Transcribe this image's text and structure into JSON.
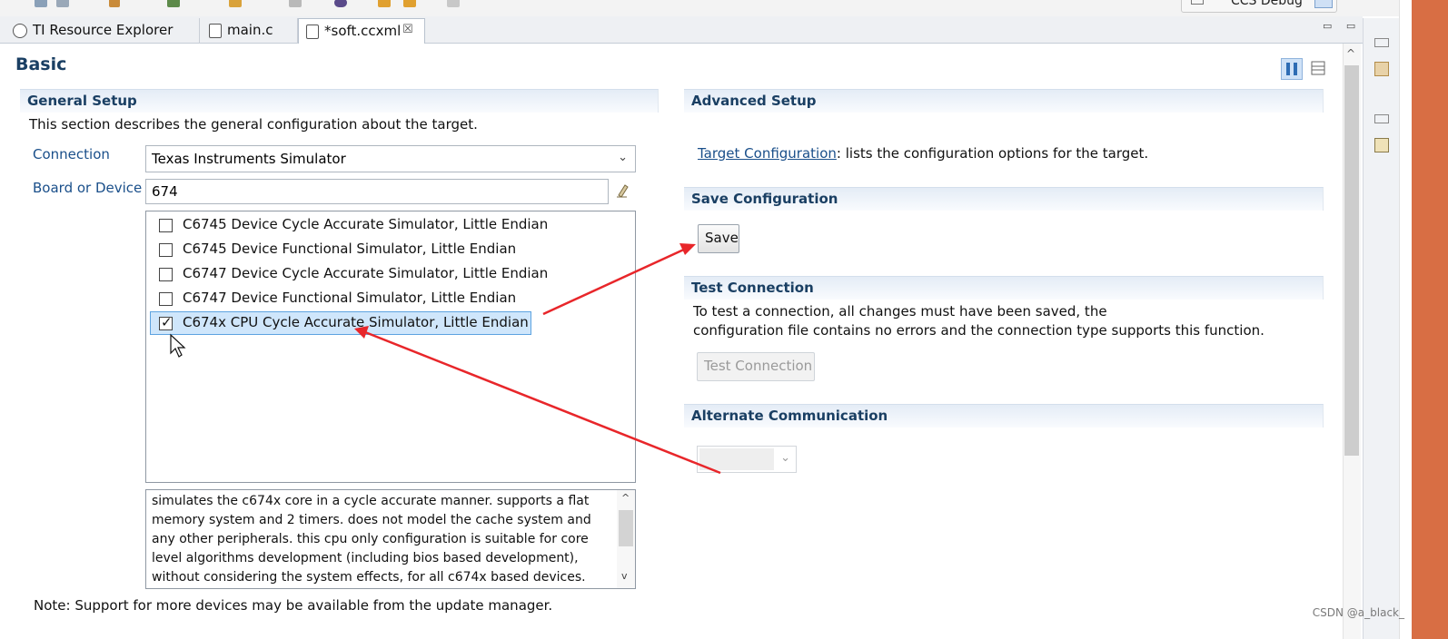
{
  "perspective": {
    "label": "CCS Debug"
  },
  "tabs": [
    {
      "label": "TI Resource Explorer",
      "icon": "compass-icon"
    },
    {
      "label": "main.c",
      "icon": "c-file-icon"
    },
    {
      "label": "*soft.ccxml",
      "icon": "target-config-file-icon",
      "active": true,
      "close": "☒"
    }
  ],
  "view_controls": "▭ ▭",
  "page": {
    "title": "Basic"
  },
  "general": {
    "header": "General Setup",
    "description": "This section describes the general configuration about the target.",
    "connection_label": "Connection",
    "connection_value": "Texas Instruments Simulator",
    "device_label": "Board or Device",
    "device_filter": "674",
    "devices": [
      {
        "label": "C6745 Device Cycle Accurate Simulator, Little Endian",
        "checked": false
      },
      {
        "label": "C6745 Device Functional Simulator, Little Endian",
        "checked": false
      },
      {
        "label": "C6747 Device Cycle Accurate Simulator, Little Endian",
        "checked": false
      },
      {
        "label": "C6747 Device Functional Simulator, Little Endian",
        "checked": false
      },
      {
        "label": "C674x CPU Cycle Accurate Simulator, Little Endian",
        "checked": true
      }
    ],
    "device_description": "simulates the c674x core in a cycle accurate manner. supports a flat memory system and 2 timers. does not model the cache system and any other peripherals.  this cpu only configuration is suitable for core level algorithms development (including bios based development), without considering the system effects, for all c674x based devices.",
    "note": "Note: Support for more devices may be available from the update manager."
  },
  "advanced": {
    "header": "Advanced Setup",
    "link_text": "Target Configuration",
    "link_suffix": ": lists the configuration options for the target."
  },
  "save": {
    "header": "Save Configuration",
    "button": "Save"
  },
  "test": {
    "header": "Test Connection",
    "line1": "To test a connection, all changes must have been saved, the",
    "line2": "configuration file contains no errors and the connection type supports this function.",
    "button": "Test Connection"
  },
  "alternate": {
    "header": "Alternate Communication"
  },
  "watermark": "CSDN @a_black_",
  "colors": {
    "annotation_arrow": "#e8262a",
    "header_text": "#1a3f63",
    "selection": "#cfe6fb"
  }
}
